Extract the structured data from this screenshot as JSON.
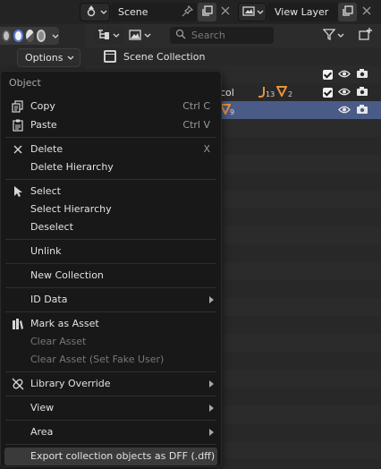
{
  "topbar": {
    "scene_label": "Scene",
    "view_layer_label": "View Layer"
  },
  "leftstrip": {
    "options_label": "Options"
  },
  "outliner": {
    "search_placeholder": "Search",
    "scene_collection_label": "Scene Collection",
    "partial_row_text": "col",
    "badge_a": "13",
    "badge_b": "2",
    "badge_c": "9"
  },
  "menu": {
    "title": "Object",
    "items": [
      {
        "label": "Copy",
        "shortcut": "Ctrl C"
      },
      {
        "label": "Paste",
        "shortcut": "Ctrl V"
      },
      {
        "label": "Delete",
        "shortcut": "X"
      },
      {
        "label": "Delete Hierarchy"
      },
      {
        "label": "Select"
      },
      {
        "label": "Select Hierarchy"
      },
      {
        "label": "Deselect"
      },
      {
        "label": "Unlink"
      },
      {
        "label": "New Collection"
      },
      {
        "label": "ID Data"
      },
      {
        "label": "Mark as Asset"
      },
      {
        "label": "Clear Asset"
      },
      {
        "label": "Clear Asset (Set Fake User)"
      },
      {
        "label": "Library Override"
      },
      {
        "label": "View"
      },
      {
        "label": "Area"
      },
      {
        "label": "Export collection objects as DFF (.dff)"
      }
    ]
  },
  "colors": {
    "selection": "#4a5b87",
    "accent_orange": "#e8923a",
    "menu_bg": "#181818"
  }
}
